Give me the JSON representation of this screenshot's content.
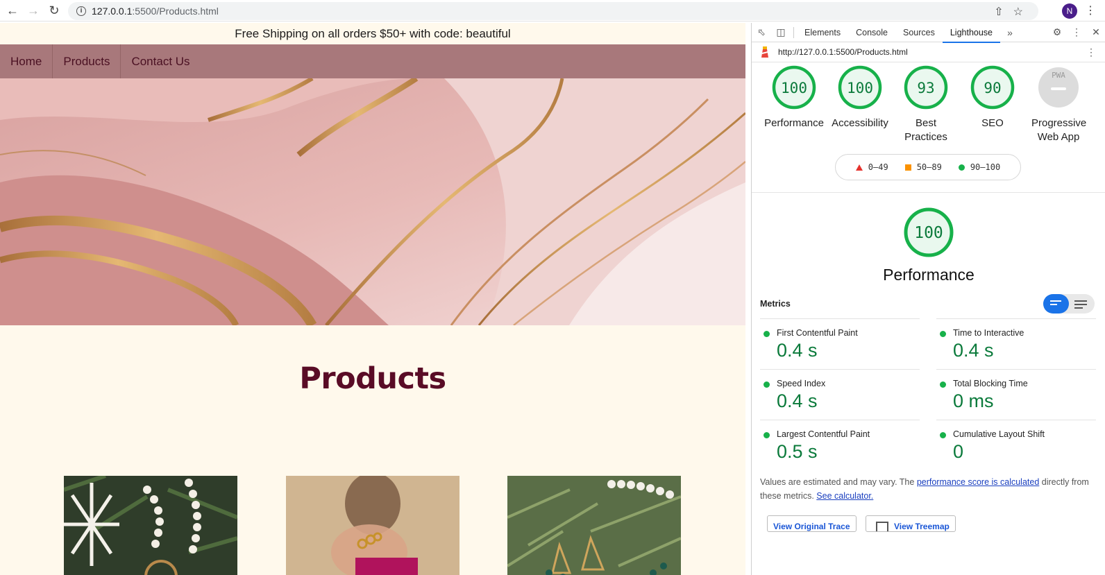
{
  "browser": {
    "url_host": "127.0.0.1",
    "url_path": ":5500/Products.html",
    "avatar_letter": "N"
  },
  "site": {
    "banner": "Free Shipping on all orders $50+ with code: beautiful",
    "nav": [
      "Home",
      "Products",
      "Contact Us"
    ],
    "heading": "Products",
    "colors": {
      "background": "#fff9ec",
      "nav": "#a8787b",
      "heading": "#590c26"
    }
  },
  "devtools": {
    "tabs": [
      "Elements",
      "Console",
      "Sources",
      "Lighthouse"
    ],
    "active_tab": "Lighthouse",
    "report_url": "http://127.0.0.1:5500/Products.html",
    "gauges": [
      {
        "score": "100",
        "label": "Performance"
      },
      {
        "score": "100",
        "label": "Accessibility"
      },
      {
        "score": "93",
        "label": "Best Practices"
      },
      {
        "score": "90",
        "label": "SEO"
      },
      {
        "score": "PWA",
        "label": "Progressive Web App"
      }
    ],
    "legend": [
      "0–49",
      "50–89",
      "90–100"
    ],
    "perf_score": "100",
    "perf_title": "Performance",
    "metrics_heading": "Metrics",
    "metrics": [
      {
        "name": "First Contentful Paint",
        "value": "0.4 s"
      },
      {
        "name": "Time to Interactive",
        "value": "0.4 s"
      },
      {
        "name": "Speed Index",
        "value": "0.4 s"
      },
      {
        "name": "Total Blocking Time",
        "value": "0 ms"
      },
      {
        "name": "Largest Contentful Paint",
        "value": "0.5 s"
      },
      {
        "name": "Cumulative Layout Shift",
        "value": "0"
      }
    ],
    "note_before": "Values are estimated and may vary. The ",
    "note_link": "performance score is calculated",
    "note_after": " directly from these metrics. ",
    "note_link2": "See calculator.",
    "buttons": [
      "View Original Trace",
      "View Treemap"
    ],
    "colors": {
      "pass": "#17b14a",
      "average": "#fb9200",
      "fail": "#e5322d",
      "accent": "#1a73e8"
    }
  }
}
